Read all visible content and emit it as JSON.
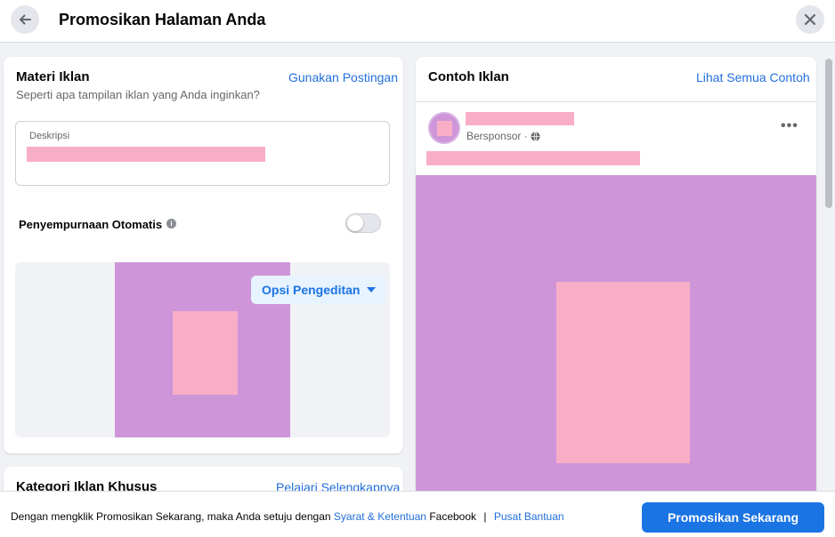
{
  "header": {
    "title": "Promosikan Halaman Anda",
    "back_icon": "arrow-left-icon",
    "close_icon": "close-icon"
  },
  "ad_material": {
    "title": "Materi Iklan",
    "link": "Gunakan Postingan",
    "subtitle": "Seperti apa tampilan iklan yang Anda inginkan?",
    "description_label": "Deskripsi",
    "auto_improve_label": "Penyempurnaan Otomatis",
    "auto_improve_enabled": false,
    "edit_options_label": "Opsi Pengeditan"
  },
  "special_category": {
    "title": "Kategori Iklan Khusus",
    "link": "Pelajari Selengkapnya"
  },
  "preview": {
    "title": "Contoh Iklan",
    "link": "Lihat Semua Contoh",
    "sponsored_label": "Bersponsor ·",
    "globe_icon": "globe-icon",
    "more_icon": "more-horizontal-icon",
    "more_glyph": "•••"
  },
  "footer": {
    "text_prefix": "Dengan mengklik Promosikan Sekarang, maka Anda setuju dengan",
    "terms_link": "Syarat & Ketentuan",
    "text_suffix": "Facebook",
    "separator": "|",
    "help_link": "Pusat Bantuan",
    "promote_button": "Promosikan Sekarang"
  },
  "colors": {
    "accent": "#1b74e4",
    "link": "#216fdb",
    "background": "#f0f2f5",
    "redaction_pink": "#f9aec8",
    "image_purple": "#ce96d8"
  }
}
